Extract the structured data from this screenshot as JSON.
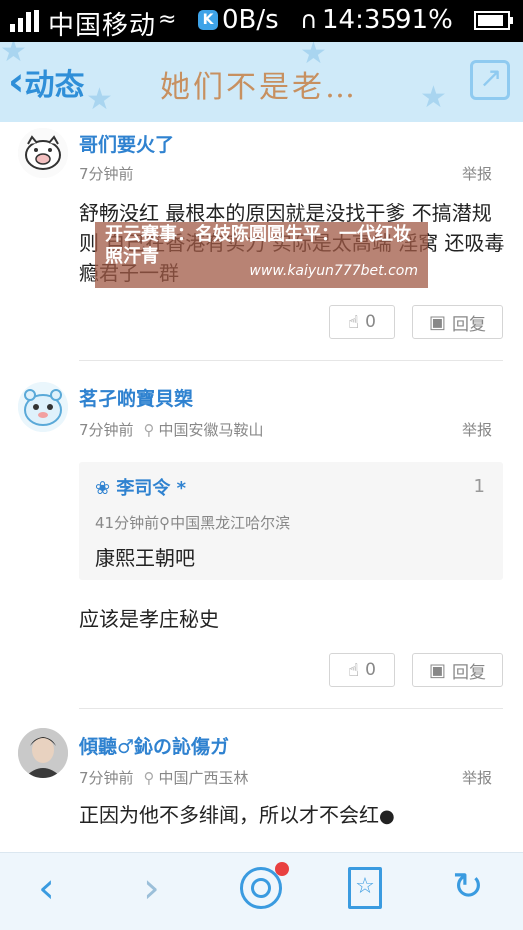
{
  "status_bar": {
    "carrier": "中国移动",
    "net_badge": "K",
    "speed": "0B/s",
    "time": "14:35",
    "battery": "91%",
    "battery_level": 0.91
  },
  "header": {
    "back_label": "动态",
    "title": "她们不是老…",
    "share_icon": "share-icon"
  },
  "comments": [
    {
      "username": "哥们要火了",
      "time": "7分钟前",
      "location": "",
      "report_label": "举报",
      "text": "舒畅没红 最根本的原因就是没找干爹 不搞潜规则 自己在香港有实力 实际是太高端 淫窝 还吸毒瘾君子一群",
      "like_count": "0",
      "reply_label": "回复"
    },
    {
      "username": "茗孑啲寶貝槊",
      "time": "7分钟前",
      "location": "中国安徽马鞍山",
      "report_label": "举报",
      "reply": {
        "username": "李司令 *",
        "floor": "1",
        "time": "41分钟前",
        "location": "中国黑龙江哈尔滨",
        "text": "康熙王朝吧"
      },
      "text": "应该是孝庄秘史",
      "like_count": "0",
      "reply_label": "回复"
    },
    {
      "username": "傾聽♂鈊の訫傷ガ",
      "time": "7分钟前",
      "location": "中国广西玉林",
      "report_label": "举报",
      "text": "正因为他不多绯闻，所以才不会红"
    }
  ],
  "banner": {
    "title": "开云赛事：名妓陈圆圆生平：一代红妆照汗青",
    "url": "www.kaiyun777bet.com"
  },
  "colors": {
    "accent": "#2f82d0",
    "header_bg": "#cfeaf9",
    "nav_bg": "#eef6fc",
    "badge_red": "#e94040"
  }
}
